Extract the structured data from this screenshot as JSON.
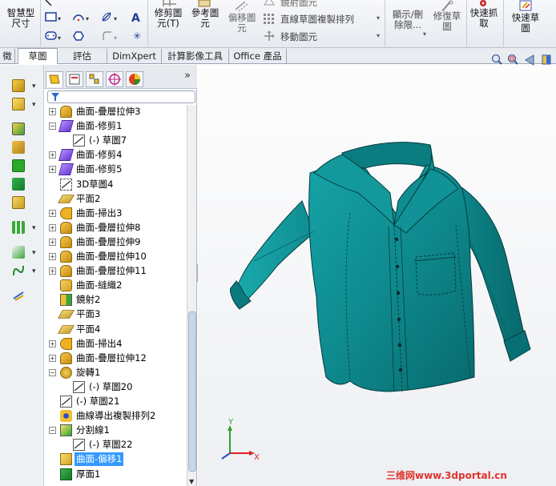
{
  "ribbon": {
    "smart_dim": "智慧型\n尺寸",
    "trim": "修剪圖\n元(T)",
    "ref": "參考圖\n元",
    "offset": "偏移圖\n元",
    "mirror": "鏡射圖元",
    "linear_pattern": "直線草圖複製排列",
    "move": "移動圖元",
    "show_hide": "顯示/刪\n除限...",
    "repair": "修復草\n圖",
    "quick_snap": "快速抓\n取",
    "rapid_sketch": "快速草\n圖"
  },
  "tabs": [
    "特徵",
    "草圖",
    "評估",
    "DimXpert",
    "計算影像工具",
    "Office 產品"
  ],
  "tabs_partial_first": "徵",
  "active_tab_index": 1,
  "tree": [
    {
      "label": "曲面-疊層拉伸3",
      "indent": 0,
      "plus": true,
      "icon": "loft-surface-icon"
    },
    {
      "label": "曲面-修剪1",
      "indent": 0,
      "plus": true,
      "icon": "trim-surface-icon",
      "expanded": true
    },
    {
      "label": "(-) 草圖7",
      "indent": 1,
      "plus": false,
      "icon": "sketch-icon"
    },
    {
      "label": "曲面-修剪4",
      "indent": 0,
      "plus": true,
      "icon": "trim-surface-icon"
    },
    {
      "label": "曲面-修剪5",
      "indent": 0,
      "plus": true,
      "icon": "trim-surface-icon"
    },
    {
      "label": "3D草圖4",
      "indent": 0,
      "plus": false,
      "icon": "3d-sketch-icon"
    },
    {
      "label": "平面2",
      "indent": 0,
      "plus": false,
      "icon": "plane-icon"
    },
    {
      "label": "曲面-掃出3",
      "indent": 0,
      "plus": true,
      "icon": "sweep-surface-icon"
    },
    {
      "label": "曲面-疊層拉伸8",
      "indent": 0,
      "plus": true,
      "icon": "loft-surface-icon"
    },
    {
      "label": "曲面-疊層拉伸9",
      "indent": 0,
      "plus": true,
      "icon": "loft-surface-icon"
    },
    {
      "label": "曲面-疊層拉伸10",
      "indent": 0,
      "plus": true,
      "icon": "loft-surface-icon"
    },
    {
      "label": "曲面-疊層拉伸11",
      "indent": 0,
      "plus": true,
      "icon": "loft-surface-icon"
    },
    {
      "label": "曲面-縫織2",
      "indent": 0,
      "plus": false,
      "icon": "knit-surface-icon"
    },
    {
      "label": "鏡射2",
      "indent": 0,
      "plus": false,
      "icon": "mirror-icon"
    },
    {
      "label": "平面3",
      "indent": 0,
      "plus": false,
      "icon": "plane-icon"
    },
    {
      "label": "平面4",
      "indent": 0,
      "plus": false,
      "icon": "plane-icon"
    },
    {
      "label": "曲面-掃出4",
      "indent": 0,
      "plus": true,
      "icon": "sweep-surface-icon"
    },
    {
      "label": "曲面-疊層拉伸12",
      "indent": 0,
      "plus": true,
      "icon": "loft-surface-icon"
    },
    {
      "label": "旋轉1",
      "indent": 0,
      "plus": true,
      "icon": "revolve-icon",
      "expanded": true
    },
    {
      "label": "(-) 草圖20",
      "indent": 1,
      "plus": false,
      "icon": "sketch-icon"
    },
    {
      "label": "(-) 草圖21",
      "indent": 0,
      "plus": false,
      "icon": "sketch-icon"
    },
    {
      "label": "曲線導出複製排列2",
      "indent": 0,
      "plus": false,
      "icon": "curve-pattern-icon"
    },
    {
      "label": "分割線1",
      "indent": 0,
      "plus": true,
      "icon": "split-line-icon",
      "expanded": true
    },
    {
      "label": "(-) 草圖22",
      "indent": 1,
      "plus": false,
      "icon": "sketch-icon"
    },
    {
      "label": "曲面-偏移1",
      "indent": 0,
      "plus": false,
      "icon": "offset-surface-icon",
      "selected": true
    },
    {
      "label": "厚面1",
      "indent": 0,
      "plus": false,
      "icon": "thicken-icon"
    }
  ],
  "triad": {
    "x": "X",
    "y": "Y"
  },
  "watermark": "三维网www.3dportal.cn",
  "colors": {
    "shirt": "#0e8a8e",
    "selection": "#3399ff",
    "watermark": "#e0322c"
  }
}
